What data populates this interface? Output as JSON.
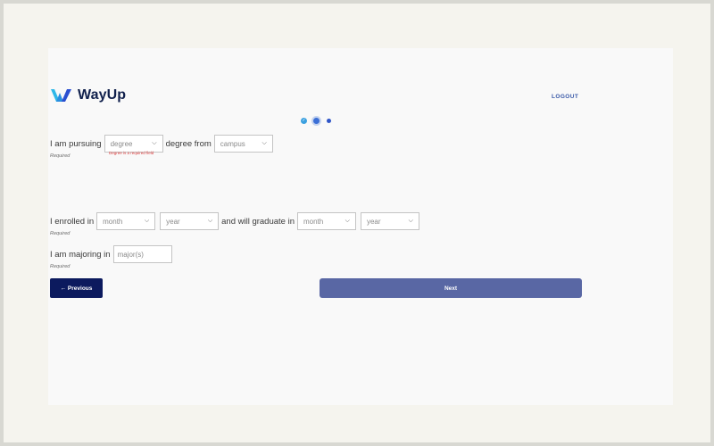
{
  "brand": {
    "name": "WayUp"
  },
  "header": {
    "logout_label": "LOGOUT"
  },
  "stepper": {
    "total": 3,
    "current": 2,
    "done_icon": "check-icon"
  },
  "form": {
    "pursuing": {
      "label_before": "I am pursuing",
      "degree_placeholder": "degree",
      "label_middle": "degree from",
      "campus_placeholder": "campus",
      "required_note": "Required",
      "error": "Degree is a required field"
    },
    "enrollment": {
      "label_before": "I enrolled in",
      "start_month_placeholder": "month",
      "start_year_placeholder": "year",
      "label_middle": "and will graduate in",
      "end_month_placeholder": "month",
      "end_year_placeholder": "year",
      "required_note": "Required"
    },
    "major": {
      "label_before": "I am majoring in",
      "placeholder": "major(s)",
      "required_note": "Required"
    }
  },
  "actions": {
    "previous_label": "← Previous",
    "next_label": "Next"
  },
  "colors": {
    "brand_navy": "#0c1a5e",
    "next_button": "#5967a4",
    "error_red": "#d83a3a",
    "logo_cyan": "#2fb8e8",
    "logo_blue": "#2a4fd0"
  }
}
